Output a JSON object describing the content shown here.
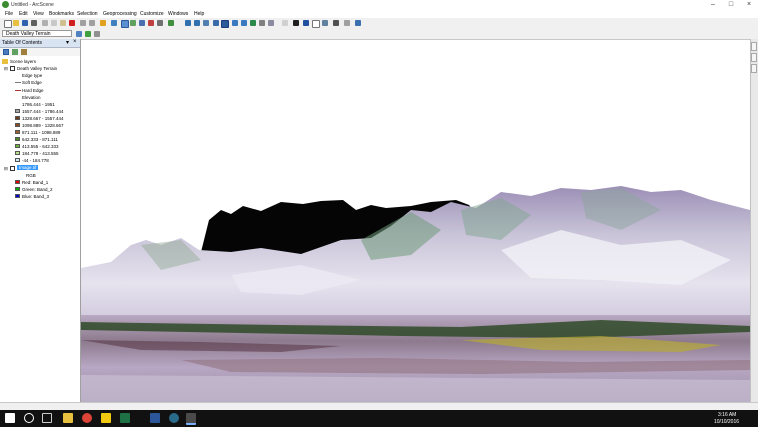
{
  "window": {
    "title": "Untitled - ArcScene"
  },
  "menubar": [
    "File",
    "Edit",
    "View",
    "Bookmarks",
    "Selection",
    "Geoprocessing",
    "Customize",
    "Windows",
    "Help"
  ],
  "toolbar": {
    "scene_selector": "Death Valley Terrain"
  },
  "toc": {
    "title": "Table Of Contents",
    "scene_layers": "Scene layers",
    "terrain_layer": "Death Valley Terrain",
    "edge_type": "Edge type",
    "soft_edge": "Soft Edge",
    "hard_edge": "Hard Edge",
    "elevation": "Elevation",
    "range_header": "1786.444 - 1951",
    "classes": [
      {
        "label": "1557.444 - 1786.444",
        "color": "#a8a8a8"
      },
      {
        "label": "1328.667 - 1557.444",
        "color": "#6b3a1f"
      },
      {
        "label": "1098.889 - 1328.667",
        "color": "#8a4a22"
      },
      {
        "label": "871.111 - 1098.889",
        "color": "#a06030"
      },
      {
        "label": "642.333 - 871.111",
        "color": "#4a8a2a"
      },
      {
        "label": "413.555 - 642.333",
        "color": "#6fb33a"
      },
      {
        "label": "184.778 - 413.555",
        "color": "#b9e08a"
      },
      {
        "label": "-44 - 184.778",
        "color": "#cfe9f2"
      }
    ],
    "image_layer": "Image.tif",
    "rgb": "RGB",
    "bands": [
      {
        "label": "Red: Band_1",
        "color": "#e00000"
      },
      {
        "label": "Green: Band_2",
        "color": "#00b000"
      },
      {
        "label": "Blue: Band_3",
        "color": "#0000d0"
      }
    ]
  },
  "taskbar": {
    "time": "3:16 AM",
    "date": "10/10/2016"
  }
}
